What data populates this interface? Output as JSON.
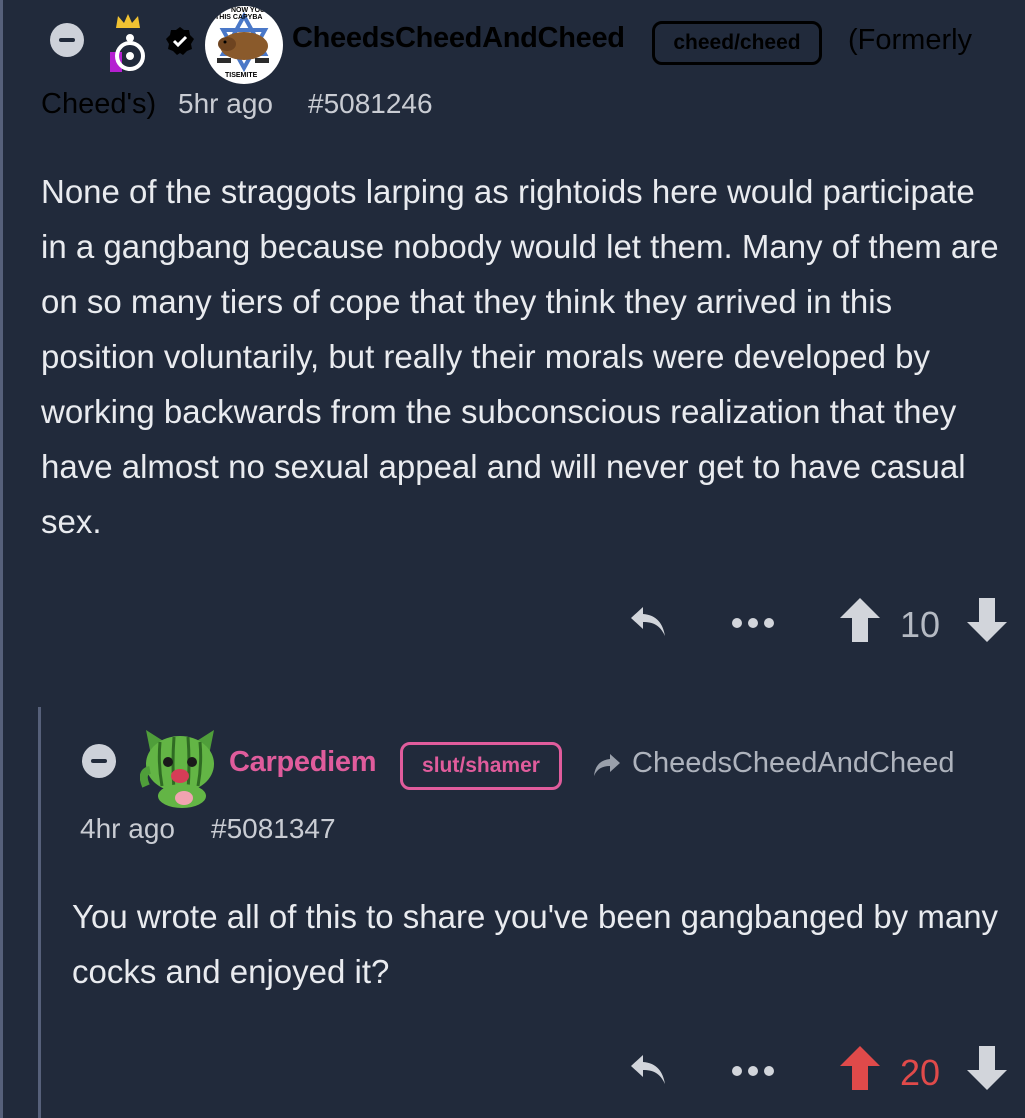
{
  "colors": {
    "background": "#212a3b",
    "text": "#e6e8ec",
    "muted": "#9aa0ab",
    "black_flair": "#000000",
    "pink_accent": "#e05c9c",
    "upvoted_red": "#e04a4a",
    "icon_grey": "#d2d5db"
  },
  "comments": [
    {
      "username": "CheedsCheedAndCheed",
      "flair": "cheed/cheed",
      "formerly_line1": "(Formerly",
      "formerly_line2": "Cheed's)",
      "time": "5hr ago",
      "id": "#5081246",
      "avatar_text_top": "NOW YOU",
      "avatar_text_mid": "THIS CAPYBA",
      "avatar_text_bottom": "TISEMITE",
      "body": "None of the straggots larping as rightoids here would participate in a gangbang because nobody would let them. Many of them are on so many tiers of cope that they think they arrived in this position voluntarily, but really their morals were developed by working backwards from the subconscious realization that they have almost no sexual appeal and will never get to have casual sex.",
      "score": "10",
      "actions": {
        "reply_icon": "reply-arrow-icon",
        "more_icon": "ellipsis-icon",
        "upvote_icon": "arrow-up-icon",
        "downvote_icon": "arrow-down-icon"
      }
    },
    {
      "username": "Carpediem",
      "flair": "slut/shamer",
      "reply_to": "CheedsCheedAndCheed",
      "time": "4hr ago",
      "id": "#5081347",
      "body": "You wrote all of this to share you've been gangbanged by many cocks and enjoyed it?",
      "score": "20",
      "upvoted": true,
      "actions": {
        "reply_icon": "reply-arrow-icon",
        "more_icon": "ellipsis-icon",
        "upvote_icon": "arrow-up-icon",
        "downvote_icon": "arrow-down-icon"
      }
    }
  ]
}
